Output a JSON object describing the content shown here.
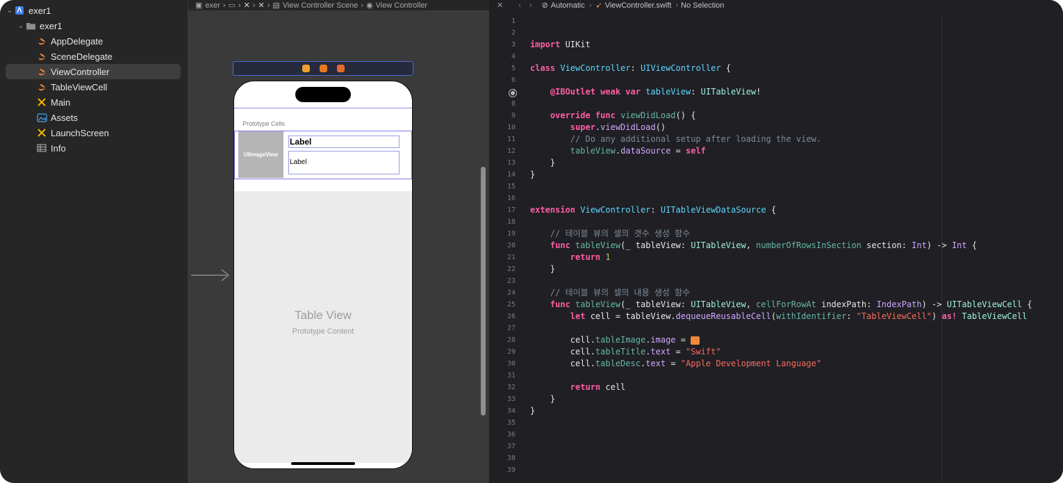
{
  "navigator": {
    "items": [
      {
        "label": "exer1",
        "icon": "xcode-project-icon",
        "level": 0,
        "expanded": true
      },
      {
        "label": "exer1",
        "icon": "folder-icon",
        "level": 1,
        "expanded": true
      },
      {
        "label": "AppDelegate",
        "icon": "swift-file-icon",
        "level": 2
      },
      {
        "label": "SceneDelegate",
        "icon": "swift-file-icon",
        "level": 2
      },
      {
        "label": "ViewController",
        "icon": "swift-file-icon",
        "level": 2,
        "selected": true
      },
      {
        "label": "TableViewCell",
        "icon": "swift-file-icon",
        "level": 2
      },
      {
        "label": "Main",
        "icon": "storyboard-icon",
        "level": 2
      },
      {
        "label": "Assets",
        "icon": "assets-icon",
        "level": 2
      },
      {
        "label": "LaunchScreen",
        "icon": "storyboard-icon",
        "level": 2
      },
      {
        "label": "Info",
        "icon": "plist-icon",
        "level": 2
      }
    ]
  },
  "canvas": {
    "breadcrumb": [
      "exer",
      "View Controller Scene",
      "View Controller"
    ],
    "prototype_cells_label": "Prototype Cells",
    "image_view_label": "UIImageView",
    "title_label": "Label",
    "desc_label": "Label",
    "table_view_title": "Table View",
    "table_view_subtitle": "Prototype Content"
  },
  "editor": {
    "breadcrumb": {
      "mode": "Automatic",
      "file": "ViewController.swift",
      "selection": "No Selection"
    },
    "accent": "#fc5fa3"
  },
  "code_lines": [
    "",
    "",
    "import UIKit",
    "",
    "class ViewController: UIViewController {",
    "",
    "    @IBOutlet weak var tableView: UITableView!",
    "",
    "    override func viewDidLoad() {",
    "        super.viewDidLoad()",
    "        // Do any additional setup after loading the view.",
    "        tableView.dataSource = self",
    "    }",
    "}",
    "",
    "",
    "extension ViewController: UITableViewDataSource {",
    "",
    "    // 테이블 뷰의 셀의 갯수 생성 함수",
    "    func tableView(_ tableView: UITableView, numberOfRowsInSection section: Int) -> Int {",
    "        return 1",
    "    }",
    "",
    "    // 테이블 뷰의 셀의 내용 생성 함수",
    "    func tableView(_ tableView: UITableView, cellForRowAt indexPath: IndexPath) -> UITableViewCell {",
    "        let cell = tableView.dequeueReusableCell(withIdentifier: \"TableViewCell\") as! TableViewCell",
    "",
    "        cell.tableImage.image = ",
    "        cell.tableTitle.text = \"Swift\"",
    "        cell.tableDesc.text = \"Apple Development Language\"",
    "",
    "        return cell",
    "    }",
    "}",
    "",
    "",
    "",
    "",
    ""
  ]
}
